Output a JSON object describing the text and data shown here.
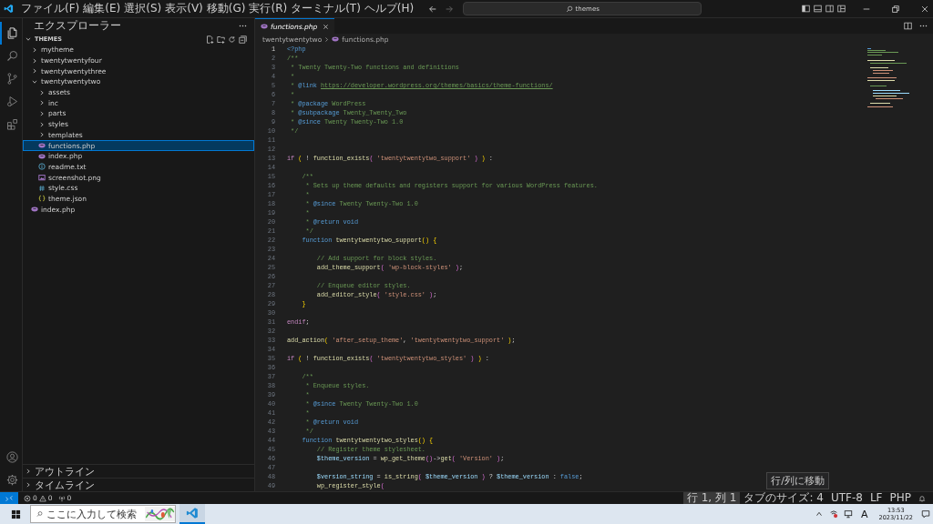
{
  "title_bar": {
    "menus": [
      "ファイル(F)",
      "編集(E)",
      "選択(S)",
      "表示(V)",
      "移動(G)",
      "実行(R)",
      "ターミナル(T)",
      "ヘルプ(H)"
    ],
    "search": {
      "value": "themes"
    }
  },
  "activity_bar": {
    "items": [
      {
        "kind": "explorer",
        "selected": true
      },
      {
        "kind": "search",
        "selected": false
      },
      {
        "kind": "source-control",
        "selected": false
      },
      {
        "kind": "run-debug",
        "selected": false
      },
      {
        "kind": "extensions",
        "selected": false
      }
    ],
    "bottom": [
      {
        "kind": "account"
      },
      {
        "kind": "settings"
      }
    ]
  },
  "sidebar": {
    "title": "エクスプローラー",
    "section": {
      "label": "THEMES",
      "expanded": true,
      "children": [
        {
          "label": "mytheme",
          "kind": "folder",
          "expanded": false,
          "selected": false
        },
        {
          "label": "twentytwentyfour",
          "kind": "folder",
          "expanded": false,
          "selected": false
        },
        {
          "label": "twentytwentythree",
          "kind": "folder",
          "expanded": false,
          "selected": false
        },
        {
          "label": "twentytwentytwo",
          "kind": "folder",
          "expanded": true,
          "selected": false,
          "children": [
            {
              "label": "assets",
              "kind": "folder",
              "expanded": false,
              "selected": false
            },
            {
              "label": "inc",
              "kind": "folder",
              "expanded": false,
              "selected": false
            },
            {
              "label": "parts",
              "kind": "folder",
              "expanded": false,
              "selected": false
            },
            {
              "label": "styles",
              "kind": "folder",
              "expanded": false,
              "selected": false
            },
            {
              "label": "templates",
              "kind": "folder",
              "expanded": false,
              "selected": false
            },
            {
              "label": "functions.php",
              "kind": "php",
              "selected": true
            },
            {
              "label": "index.php",
              "kind": "php",
              "selected": false
            },
            {
              "label": "readme.txt",
              "kind": "txt",
              "selected": false
            },
            {
              "label": "screenshot.png",
              "kind": "png",
              "selected": false
            },
            {
              "label": "style.css",
              "kind": "css",
              "selected": false
            },
            {
              "label": "theme.json",
              "kind": "json",
              "selected": false
            }
          ]
        },
        {
          "label": "index.php",
          "kind": "php",
          "selected": false
        }
      ]
    },
    "panels": [
      {
        "label": "アウトライン",
        "expanded": false
      },
      {
        "label": "タイムライン",
        "expanded": false
      }
    ]
  },
  "editor": {
    "tabs": [
      {
        "label": "functions.php",
        "selected": true,
        "preview": true
      }
    ],
    "breadcrumb": [
      {
        "label": "twentytwentytwo",
        "kind": "folder"
      },
      {
        "label": "functions.php",
        "kind": "php"
      }
    ],
    "lines": [
      {
        "number": "1",
        "current": true,
        "tokens": [
          {
            "kind": "tag",
            "text": "<?php"
          }
        ]
      },
      {
        "number": "2",
        "current": false,
        "tokens": [
          {
            "kind": "comment",
            "text": "/**"
          }
        ]
      },
      {
        "number": "3",
        "current": false,
        "tokens": [
          {
            "kind": "comment",
            "text": " * Twenty Twenty-Two functions and definitions"
          }
        ]
      },
      {
        "number": "4",
        "current": false,
        "tokens": [
          {
            "kind": "comment",
            "text": " *"
          }
        ]
      },
      {
        "number": "5",
        "current": false,
        "tokens": [
          {
            "kind": "comment",
            "text": " * "
          },
          {
            "kind": "doctag",
            "text": "@link "
          },
          {
            "kind": "link",
            "text": "https://developer.wordpress.org/themes/basics/theme-functions/"
          }
        ]
      },
      {
        "number": "6",
        "current": false,
        "tokens": [
          {
            "kind": "comment",
            "text": " *"
          }
        ]
      },
      {
        "number": "7",
        "current": false,
        "tokens": [
          {
            "kind": "comment",
            "text": " * "
          },
          {
            "kind": "doctag",
            "text": "@package"
          },
          {
            "kind": "comment",
            "text": " WordPress"
          }
        ]
      },
      {
        "number": "8",
        "current": false,
        "tokens": [
          {
            "kind": "comment",
            "text": " * "
          },
          {
            "kind": "doctag",
            "text": "@subpackage"
          },
          {
            "kind": "comment",
            "text": " Twenty_Twenty_Two"
          }
        ]
      },
      {
        "number": "9",
        "current": false,
        "tokens": [
          {
            "kind": "comment",
            "text": " * "
          },
          {
            "kind": "doctag",
            "text": "@since"
          },
          {
            "kind": "comment",
            "text": " Twenty Twenty-Two 1.0"
          }
        ]
      },
      {
        "number": "10",
        "current": false,
        "tokens": [
          {
            "kind": "comment",
            "text": " */"
          }
        ]
      },
      {
        "number": "11",
        "current": false
      },
      {
        "number": "12",
        "current": false
      },
      {
        "number": "13",
        "current": false,
        "tokens": [
          {
            "kind": "keyword",
            "text": "if "
          },
          {
            "kind": "paren1",
            "text": "("
          },
          {
            "kind": "plain",
            "text": " ! "
          },
          {
            "kind": "function",
            "text": "function_exists"
          },
          {
            "kind": "paren2",
            "text": "( "
          },
          {
            "kind": "string",
            "text": "'twentytwentytwo_support' "
          },
          {
            "kind": "paren2",
            "text": ") "
          },
          {
            "kind": "paren1",
            "text": ")"
          },
          {
            "kind": "plain",
            "text": " :"
          }
        ]
      },
      {
        "number": "14",
        "current": false
      },
      {
        "number": "15",
        "current": false,
        "tokens": [
          {
            "kind": "comment",
            "text": "    /**"
          }
        ]
      },
      {
        "number": "16",
        "current": false,
        "tokens": [
          {
            "kind": "comment",
            "text": "     * Sets up theme defaults and registers support for various WordPress features."
          }
        ]
      },
      {
        "number": "17",
        "current": false,
        "tokens": [
          {
            "kind": "comment",
            "text": "     *"
          }
        ]
      },
      {
        "number": "18",
        "current": false,
        "tokens": [
          {
            "kind": "comment",
            "text": "     * "
          },
          {
            "kind": "doctag",
            "text": "@since"
          },
          {
            "kind": "comment",
            "text": " Twenty Twenty-Two 1.0"
          }
        ]
      },
      {
        "number": "19",
        "current": false,
        "tokens": [
          {
            "kind": "comment",
            "text": "     *"
          }
        ]
      },
      {
        "number": "20",
        "current": false,
        "tokens": [
          {
            "kind": "comment",
            "text": "     * "
          },
          {
            "kind": "doctag",
            "text": "@return void"
          }
        ]
      },
      {
        "number": "21",
        "current": false,
        "tokens": [
          {
            "kind": "comment",
            "text": "     */"
          }
        ]
      },
      {
        "number": "22",
        "current": false,
        "tokens": [
          {
            "kind": "storage",
            "text": "    function "
          },
          {
            "kind": "function",
            "text": "twentytwentytwo_support"
          },
          {
            "kind": "paren1",
            "text": "() {"
          }
        ]
      },
      {
        "number": "23",
        "current": false
      },
      {
        "number": "24",
        "current": false,
        "tokens": [
          {
            "kind": "comment",
            "text": "        // Add support for block styles."
          }
        ]
      },
      {
        "number": "25",
        "current": false,
        "tokens": [
          {
            "kind": "function",
            "text": "        add_theme_support"
          },
          {
            "kind": "paren2",
            "text": "( "
          },
          {
            "kind": "string",
            "text": "'wp-block-styles' "
          },
          {
            "kind": "paren2",
            "text": ")"
          },
          {
            "kind": "plain",
            "text": ";"
          }
        ]
      },
      {
        "number": "26",
        "current": false
      },
      {
        "number": "27",
        "current": false,
        "tokens": [
          {
            "kind": "comment",
            "text": "        // Enqueue editor styles."
          }
        ]
      },
      {
        "number": "28",
        "current": false,
        "tokens": [
          {
            "kind": "function",
            "text": "        add_editor_style"
          },
          {
            "kind": "paren2",
            "text": "( "
          },
          {
            "kind": "string",
            "text": "'style.css' "
          },
          {
            "kind": "paren2",
            "text": ")"
          },
          {
            "kind": "plain",
            "text": ";"
          }
        ]
      },
      {
        "number": "29",
        "current": false,
        "tokens": [
          {
            "kind": "paren1",
            "text": "    }"
          }
        ]
      },
      {
        "number": "30",
        "current": false
      },
      {
        "number": "31",
        "current": false,
        "tokens": [
          {
            "kind": "keyword",
            "text": "endif"
          },
          {
            "kind": "plain",
            "text": ";"
          }
        ]
      },
      {
        "number": "32",
        "current": false
      },
      {
        "number": "33",
        "current": false,
        "tokens": [
          {
            "kind": "function",
            "text": "add_action"
          },
          {
            "kind": "paren1",
            "text": "( "
          },
          {
            "kind": "string",
            "text": "'after_setup_theme'"
          },
          {
            "kind": "plain",
            "text": ", "
          },
          {
            "kind": "string",
            "text": "'twentytwentytwo_support' "
          },
          {
            "kind": "paren1",
            "text": ")"
          },
          {
            "kind": "plain",
            "text": ";"
          }
        ]
      },
      {
        "number": "34",
        "current": false
      },
      {
        "number": "35",
        "current": false,
        "tokens": [
          {
            "kind": "keyword",
            "text": "if "
          },
          {
            "kind": "paren1",
            "text": "("
          },
          {
            "kind": "plain",
            "text": " ! "
          },
          {
            "kind": "function",
            "text": "function_exists"
          },
          {
            "kind": "paren2",
            "text": "( "
          },
          {
            "kind": "string",
            "text": "'twentytwentytwo_styles' "
          },
          {
            "kind": "paren2",
            "text": ") "
          },
          {
            "kind": "paren1",
            "text": ")"
          },
          {
            "kind": "plain",
            "text": " :"
          }
        ]
      },
      {
        "number": "36",
        "current": false
      },
      {
        "number": "37",
        "current": false,
        "tokens": [
          {
            "kind": "comment",
            "text": "    /**"
          }
        ]
      },
      {
        "number": "38",
        "current": false,
        "tokens": [
          {
            "kind": "comment",
            "text": "     * Enqueue styles."
          }
        ]
      },
      {
        "number": "39",
        "current": false,
        "tokens": [
          {
            "kind": "comment",
            "text": "     *"
          }
        ]
      },
      {
        "number": "40",
        "current": false,
        "tokens": [
          {
            "kind": "comment",
            "text": "     * "
          },
          {
            "kind": "doctag",
            "text": "@since"
          },
          {
            "kind": "comment",
            "text": " Twenty Twenty-Two 1.0"
          }
        ]
      },
      {
        "number": "41",
        "current": false,
        "tokens": [
          {
            "kind": "comment",
            "text": "     *"
          }
        ]
      },
      {
        "number": "42",
        "current": false,
        "tokens": [
          {
            "kind": "comment",
            "text": "     * "
          },
          {
            "kind": "doctag",
            "text": "@return void"
          }
        ]
      },
      {
        "number": "43",
        "current": false,
        "tokens": [
          {
            "kind": "comment",
            "text": "     */"
          }
        ]
      },
      {
        "number": "44",
        "current": false,
        "tokens": [
          {
            "kind": "storage",
            "text": "    function "
          },
          {
            "kind": "function",
            "text": "twentytwentytwo_styles"
          },
          {
            "kind": "paren1",
            "text": "() {"
          }
        ]
      },
      {
        "number": "45",
        "current": false,
        "tokens": [
          {
            "kind": "comment",
            "text": "        // Register theme stylesheet."
          }
        ]
      },
      {
        "number": "46",
        "current": false,
        "tokens": [
          {
            "kind": "variable",
            "text": "        $theme_version"
          },
          {
            "kind": "plain",
            "text": " = "
          },
          {
            "kind": "function",
            "text": "wp_get_theme"
          },
          {
            "kind": "paren2",
            "text": "()"
          },
          {
            "kind": "plain",
            "text": "->"
          },
          {
            "kind": "function",
            "text": "get"
          },
          {
            "kind": "paren2",
            "text": "( "
          },
          {
            "kind": "string",
            "text": "'Version' "
          },
          {
            "kind": "paren2",
            "text": ")"
          },
          {
            "kind": "plain",
            "text": ";"
          }
        ]
      },
      {
        "number": "47",
        "current": false
      },
      {
        "number": "48",
        "current": false,
        "tokens": [
          {
            "kind": "variable",
            "text": "        $version_string"
          },
          {
            "kind": "plain",
            "text": " = "
          },
          {
            "kind": "function",
            "text": "is_string"
          },
          {
            "kind": "paren2",
            "text": "( "
          },
          {
            "kind": "variable",
            "text": "$theme_version "
          },
          {
            "kind": "paren2",
            "text": ")"
          },
          {
            "kind": "plain",
            "text": " ? "
          },
          {
            "kind": "variable",
            "text": "$theme_version"
          },
          {
            "kind": "plain",
            "text": " : "
          },
          {
            "kind": "bool",
            "text": "false"
          },
          {
            "kind": "plain",
            "text": ";"
          }
        ]
      },
      {
        "number": "49",
        "current": false,
        "tokens": [
          {
            "kind": "function",
            "text": "        wp_register_style"
          },
          {
            "kind": "paren2",
            "text": "("
          }
        ]
      }
    ],
    "tooltip": "行/列に移動"
  },
  "status_bar": {
    "errors": "0",
    "warnings": "0",
    "ports": "0",
    "items": [
      {
        "label": "行 1, 列 1",
        "selected": true
      },
      {
        "label": "タブのサイズ: 4",
        "selected": false
      },
      {
        "label": "UTF-8",
        "selected": false
      },
      {
        "label": "LF",
        "selected": false
      },
      {
        "label": "PHP",
        "selected": false
      }
    ]
  },
  "taskbar": {
    "search_placeholder": "ここに入力して検索",
    "ime": "A",
    "time": "13:53",
    "date": "2023/11/22"
  }
}
